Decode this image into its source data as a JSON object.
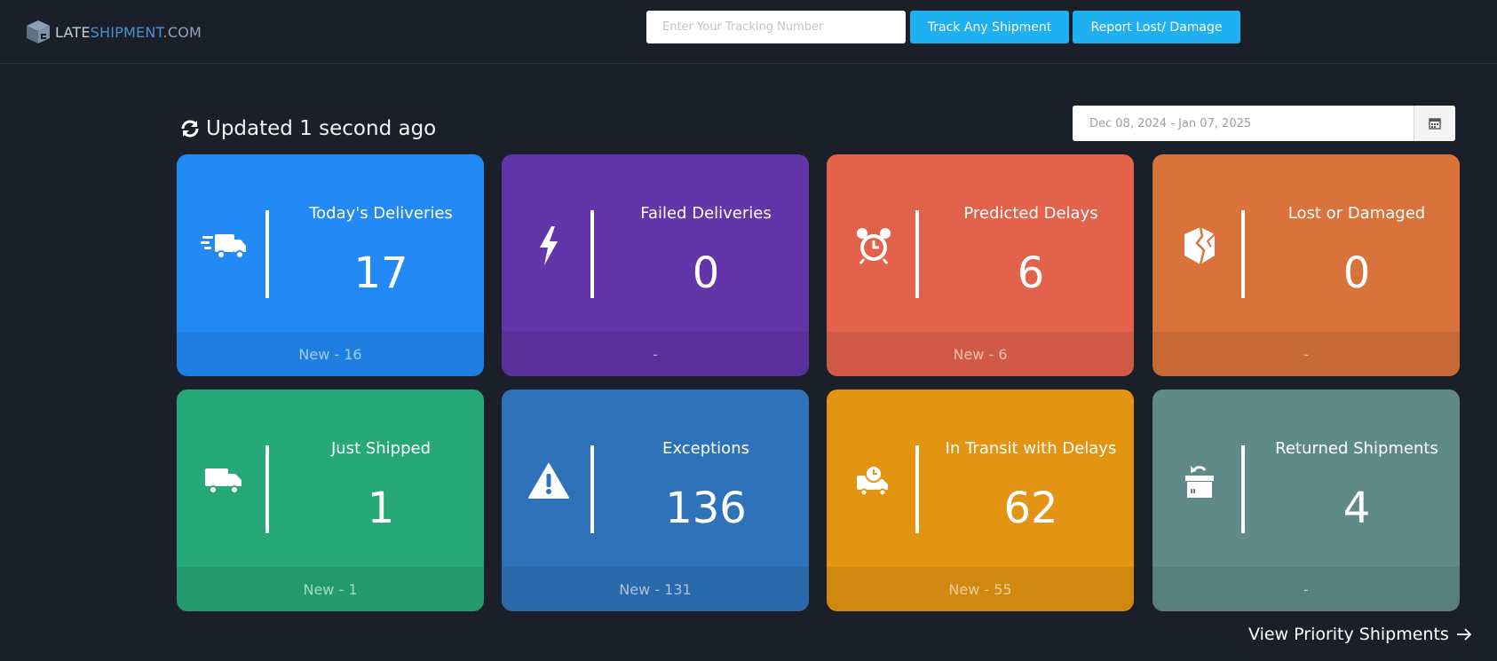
{
  "header": {
    "logo": {
      "part1": "LATE",
      "part2": "SHIPMENT",
      "part3": ".COM"
    },
    "tracking_input": {
      "placeholder": "Enter Your Tracking Number",
      "value": ""
    },
    "track_button": "Track Any Shipment",
    "report_button": "Report Lost/ Damage"
  },
  "status": {
    "updated_text": "Updated 1 second ago"
  },
  "date_range": {
    "value": "Dec 08, 2024 - Jan 07, 2025"
  },
  "cards": [
    {
      "title": "Today's Deliveries",
      "value": "17",
      "footer": "New - 16",
      "color": "#2289f5",
      "icon": "fast-truck-icon"
    },
    {
      "title": "Failed Deliveries",
      "value": "0",
      "footer": "-",
      "color": "#6236a8",
      "icon": "lightning-icon"
    },
    {
      "title": "Predicted Delays",
      "value": "6",
      "footer": "New - 6",
      "color": "#e2624b",
      "icon": "alarm-clock-icon"
    },
    {
      "title": "Lost or Damaged",
      "value": "0",
      "footer": "-",
      "color": "#d9733b",
      "icon": "broken-box-icon"
    },
    {
      "title": "Just Shipped",
      "value": "1",
      "footer": "New - 1",
      "color": "#27a878",
      "icon": "truck-icon"
    },
    {
      "title": "Exceptions",
      "value": "136",
      "footer": "New - 131",
      "color": "#2e72b9",
      "icon": "warning-icon"
    },
    {
      "title": "In Transit with Delays",
      "value": "62",
      "footer": "New - 55",
      "color": "#e29412",
      "icon": "delayed-truck-icon"
    },
    {
      "title": "Returned Shipments",
      "value": "4",
      "footer": "-",
      "color": "#5f8a87",
      "icon": "return-box-icon"
    }
  ],
  "priority_link": "View Priority Shipments"
}
